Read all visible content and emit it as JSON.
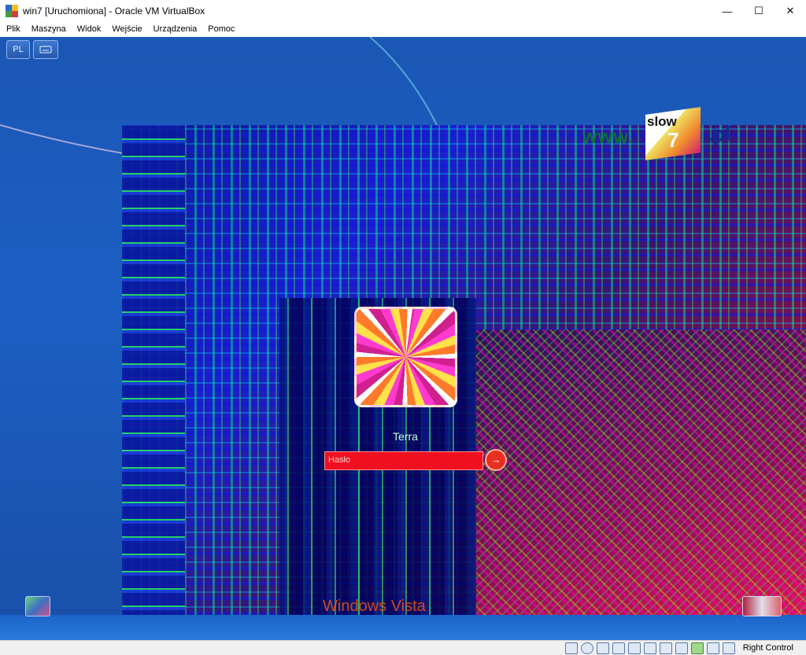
{
  "window": {
    "title": "win7 [Uruchomiona] - Oracle VM VirtualBox",
    "controls": {
      "minimize": "—",
      "maximize": "☐",
      "close": "✕"
    }
  },
  "menu": [
    "Plik",
    "Maszyna",
    "Widok",
    "Wejście",
    "Urządzenia",
    "Pomoc"
  ],
  "guest": {
    "language_button": "PL",
    "keyboard_button_icon": "keyboard-icon",
    "watermark": {
      "prefix": "www.",
      "slow": "slow",
      "seven": "7",
      "suffix": ".pl"
    },
    "login": {
      "user_name": "Terra",
      "password_placeholder": "Hasło",
      "go_icon": "arrow-right-icon"
    },
    "brand": "Windows Vista",
    "ease_of_access_icon": "ease-of-access-icon",
    "power_icon": "power-icon"
  },
  "statusbar": {
    "icons": [
      "hard-disk-icon",
      "optical-drive-icon",
      "audio-icon",
      "network-icon",
      "usb-icon",
      "shared-folder-icon",
      "display-icon",
      "video-capture-icon",
      "cpu-icon",
      "mouse-integration-icon",
      "keyboard-capture-icon"
    ],
    "host_key": "Right Control"
  }
}
